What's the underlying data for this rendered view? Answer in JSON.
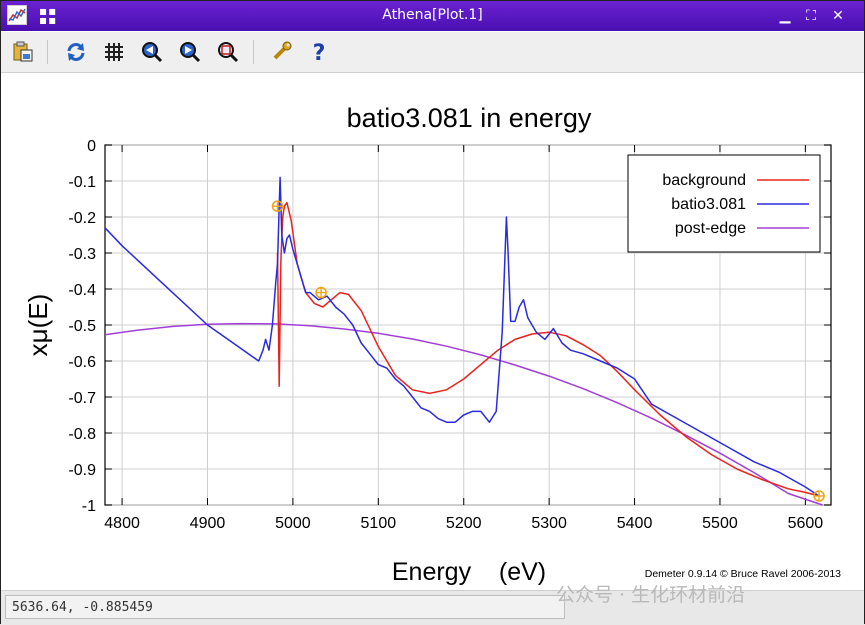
{
  "window": {
    "title": "Athena[Plot.1]",
    "controls": [
      "minimize-icon",
      "maximize-icon",
      "close-icon"
    ]
  },
  "toolbar": {
    "buttons": [
      {
        "name": "save-plot-button",
        "icon": "clipboard-icon"
      },
      {
        "name": "replot-button",
        "icon": "refresh-icon"
      },
      {
        "name": "toggle-grid-button",
        "icon": "grid-icon"
      },
      {
        "name": "zoom-out-button",
        "icon": "zoom-out-icon"
      },
      {
        "name": "zoom-in-button",
        "icon": "zoom-in-icon"
      },
      {
        "name": "zoom-reset-button",
        "icon": "zoom-reset-icon"
      },
      {
        "name": "settings-button",
        "icon": "wrench-icon"
      },
      {
        "name": "help-button",
        "icon": "help-icon"
      }
    ]
  },
  "status": {
    "cursor_readout": "5636.64, -0.885459"
  },
  "watermark": "公众号 · 生化环材前沿",
  "chart_data": {
    "type": "line",
    "title": "batio3.081 in energy",
    "xlabel": "Energy    (eV)",
    "ylabel": "xμ(E)",
    "xlim": [
      4780,
      5630
    ],
    "ylim": [
      -1,
      0
    ],
    "xticks": [
      4800,
      4900,
      5000,
      5100,
      5200,
      5300,
      5400,
      5500,
      5600
    ],
    "yticks": [
      0,
      -0.1,
      -0.2,
      -0.3,
      -0.4,
      -0.5,
      -0.6,
      -0.7,
      -0.8,
      -0.9,
      -1
    ],
    "grid": true,
    "legend_position": "top-right",
    "credit": "Demeter 0.9.14 © Bruce Ravel 2006-2013",
    "colors": {
      "background": "#e8231d",
      "batio3.081": "#2a2ae0",
      "post-edge": "#a23ed8",
      "marker": "#f2a516"
    },
    "series": [
      {
        "name": "background",
        "x": [
          4982,
          4984,
          4986,
          4988,
          4990,
          4993,
          4998,
          5005,
          5015,
          5025,
          5035,
          5045,
          5055,
          5065,
          5080,
          5100,
          5120,
          5140,
          5160,
          5180,
          5200,
          5220,
          5240,
          5260,
          5280,
          5300,
          5320,
          5340,
          5360,
          5380,
          5400,
          5430,
          5460,
          5490,
          5520,
          5550,
          5580,
          5600,
          5616
        ],
        "values": [
          -0.3,
          -0.67,
          -0.32,
          -0.2,
          -0.17,
          -0.16,
          -0.21,
          -0.33,
          -0.41,
          -0.44,
          -0.45,
          -0.43,
          -0.41,
          -0.415,
          -0.46,
          -0.56,
          -0.64,
          -0.68,
          -0.69,
          -0.68,
          -0.65,
          -0.61,
          -0.57,
          -0.54,
          -0.525,
          -0.52,
          -0.53,
          -0.555,
          -0.585,
          -0.63,
          -0.68,
          -0.75,
          -0.81,
          -0.86,
          -0.9,
          -0.93,
          -0.955,
          -0.965,
          -0.975
        ]
      },
      {
        "name": "batio3.081",
        "x": [
          4780,
          4800,
          4850,
          4900,
          4930,
          4960,
          4965,
          4968,
          4972,
          4976,
          4980,
          4982,
          4984,
          4985,
          4987,
          4990,
          4993,
          4996,
          5000,
          5005,
          5010,
          5015,
          5020,
          5030,
          5040,
          5050,
          5060,
          5070,
          5080,
          5090,
          5100,
          5110,
          5120,
          5130,
          5140,
          5150,
          5160,
          5170,
          5180,
          5190,
          5200,
          5210,
          5220,
          5230,
          5238,
          5245,
          5250,
          5252,
          5255,
          5260,
          5265,
          5270,
          5275,
          5285,
          5295,
          5305,
          5315,
          5325,
          5340,
          5360,
          5380,
          5400,
          5420,
          5450,
          5480,
          5510,
          5540,
          5570,
          5600,
          5616
        ],
        "values": [
          -0.23,
          -0.28,
          -0.39,
          -0.5,
          -0.55,
          -0.6,
          -0.57,
          -0.54,
          -0.57,
          -0.5,
          -0.38,
          -0.33,
          -0.17,
          -0.09,
          -0.25,
          -0.3,
          -0.26,
          -0.25,
          -0.29,
          -0.33,
          -0.37,
          -0.41,
          -0.41,
          -0.43,
          -0.42,
          -0.45,
          -0.47,
          -0.5,
          -0.55,
          -0.58,
          -0.61,
          -0.62,
          -0.65,
          -0.67,
          -0.7,
          -0.73,
          -0.74,
          -0.76,
          -0.77,
          -0.77,
          -0.75,
          -0.74,
          -0.74,
          -0.77,
          -0.74,
          -0.52,
          -0.2,
          -0.3,
          -0.49,
          -0.49,
          -0.45,
          -0.43,
          -0.48,
          -0.52,
          -0.54,
          -0.51,
          -0.55,
          -0.57,
          -0.58,
          -0.6,
          -0.62,
          -0.65,
          -0.72,
          -0.76,
          -0.8,
          -0.84,
          -0.88,
          -0.91,
          -0.95,
          -0.975
        ]
      },
      {
        "name": "post-edge",
        "x": [
          4780,
          4820,
          4860,
          4900,
          4940,
          4980,
          5020,
          5060,
          5100,
          5140,
          5180,
          5220,
          5260,
          5300,
          5340,
          5380,
          5420,
          5460,
          5500,
          5540,
          5580,
          5620
        ],
        "values": [
          -0.527,
          -0.514,
          -0.504,
          -0.498,
          -0.496,
          -0.497,
          -0.502,
          -0.511,
          -0.523,
          -0.539,
          -0.559,
          -0.583,
          -0.611,
          -0.642,
          -0.677,
          -0.716,
          -0.759,
          -0.806,
          -0.856,
          -0.91,
          -0.968,
          -1.03
        ]
      }
    ],
    "markers": [
      {
        "x": 4982,
        "y": -0.17
      },
      {
        "x": 5033,
        "y": -0.41
      },
      {
        "x": 5616,
        "y": -0.975
      }
    ]
  }
}
